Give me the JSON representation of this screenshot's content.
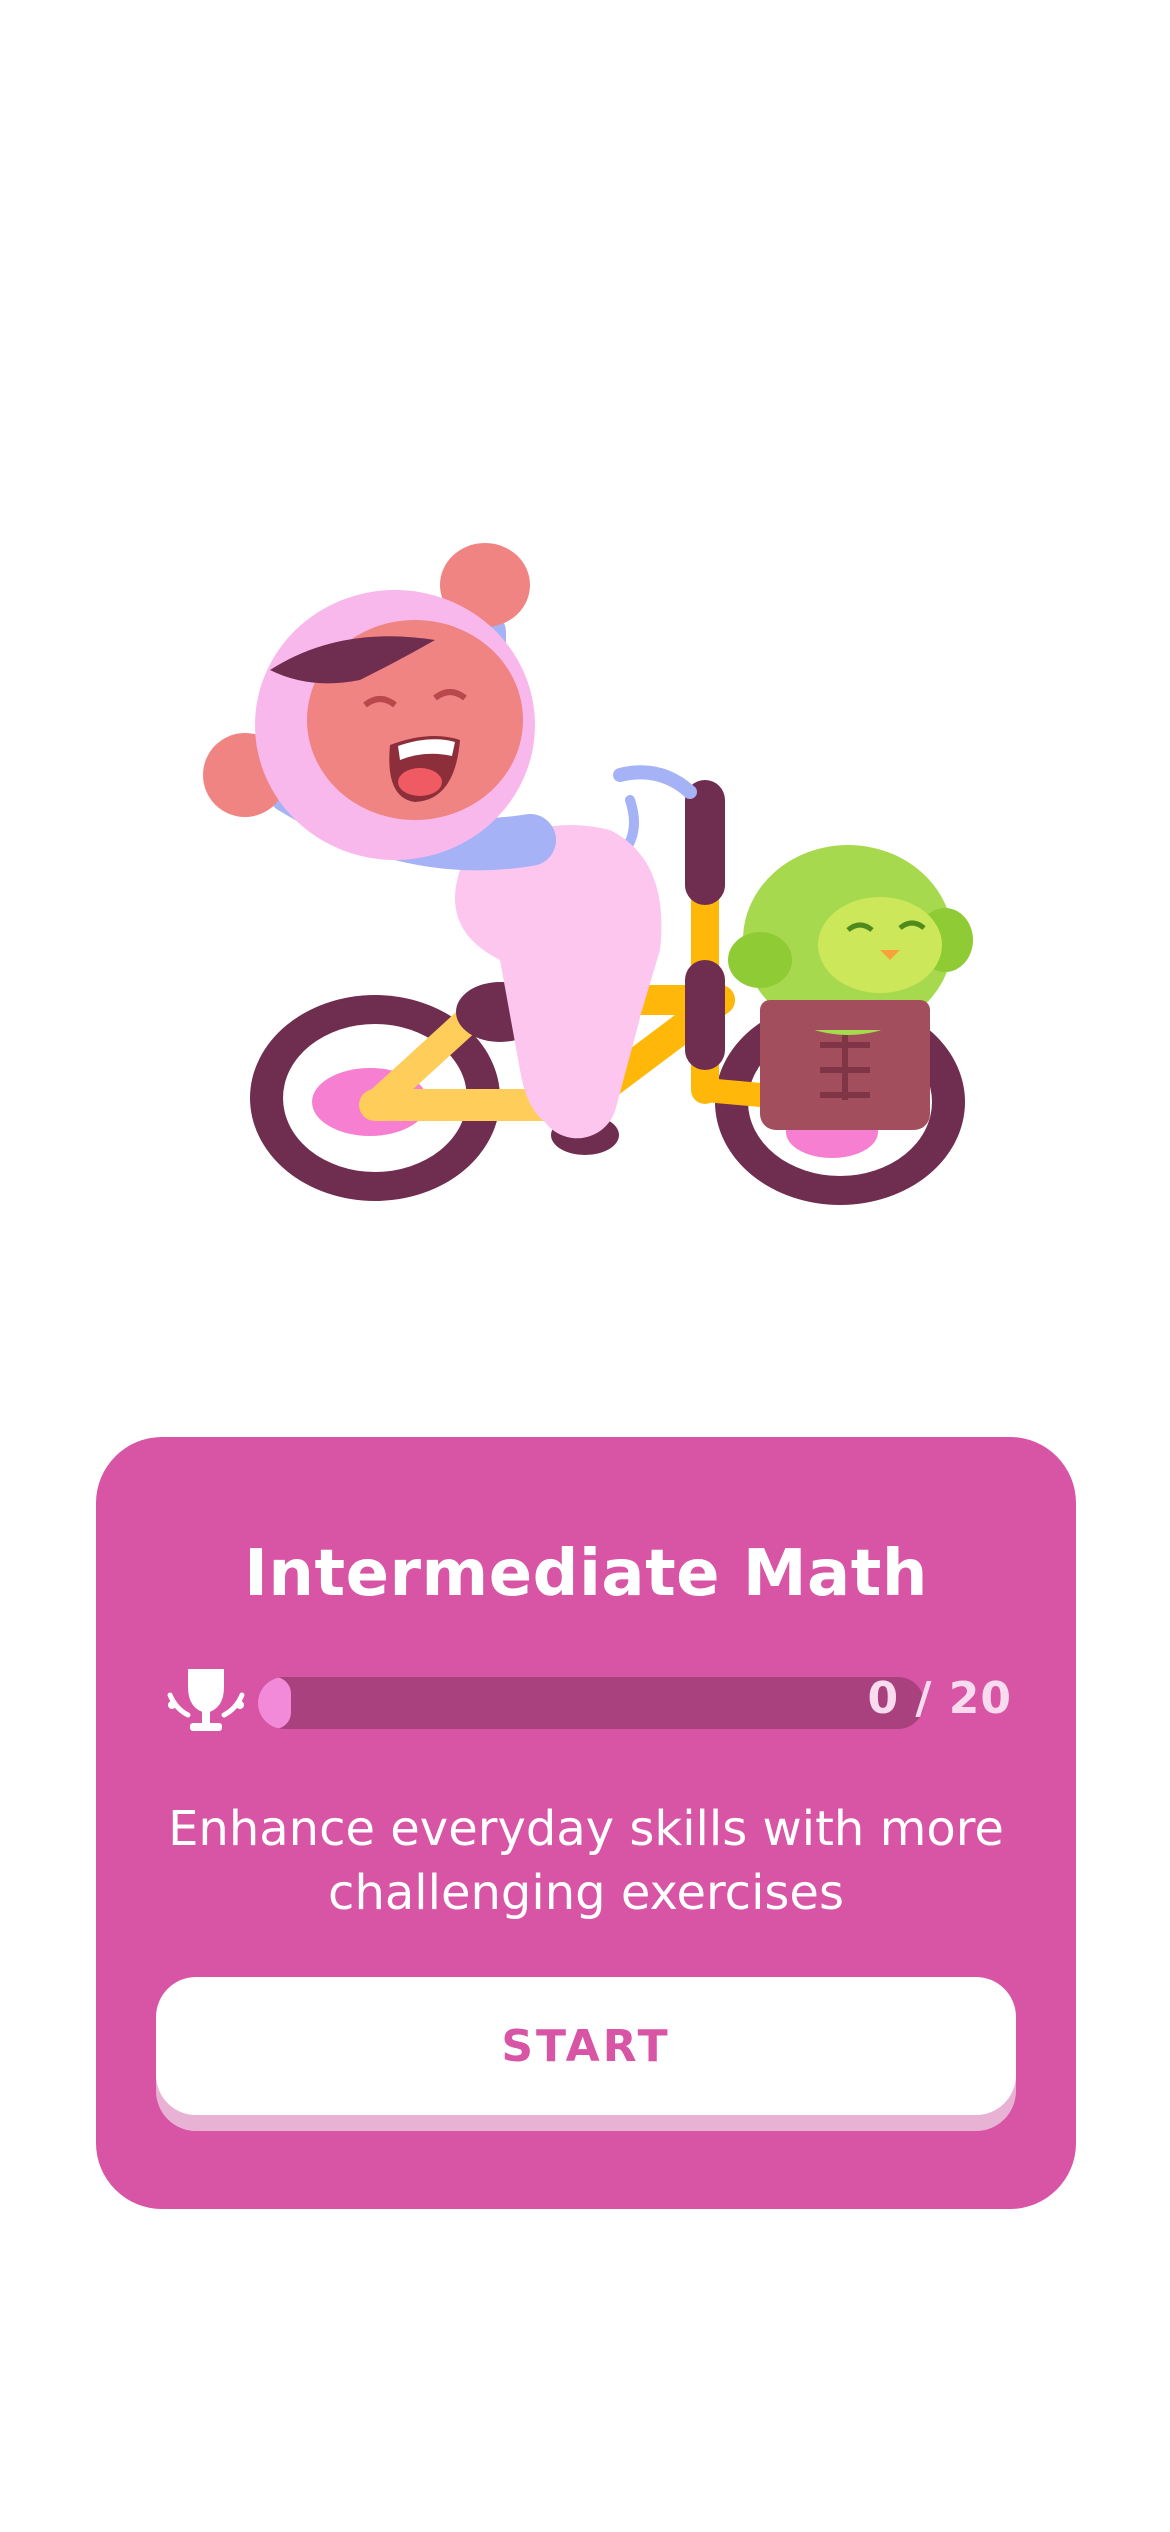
{
  "illustration": {
    "icon": "cyclist-mascot-illustration",
    "colors": {
      "skin": "#f08482",
      "hijab": "#f9b8ec",
      "sleeve": "#a5b2f6",
      "bike_frame": "#ffb80a",
      "tire": "#6f2d4f",
      "basket": "#a24e5c",
      "owl": "#a6d94d"
    }
  },
  "card": {
    "title": "Intermediate Math",
    "progress": {
      "current": 0,
      "total": 20,
      "label": "0 / 20",
      "fraction": 0.0
    },
    "trophy_icon": "trophy-icon",
    "description_line1": "Enhance everyday skills with more",
    "description_line2": "challenging exercises",
    "start_label": "START"
  },
  "colors": {
    "card_background": "#d854a4",
    "progress_track": "#a9417f",
    "progress_fill": "#f28ad9",
    "button_background": "#ffffff",
    "button_text": "#d854a4",
    "button_shadow": "#e8b2d4"
  }
}
